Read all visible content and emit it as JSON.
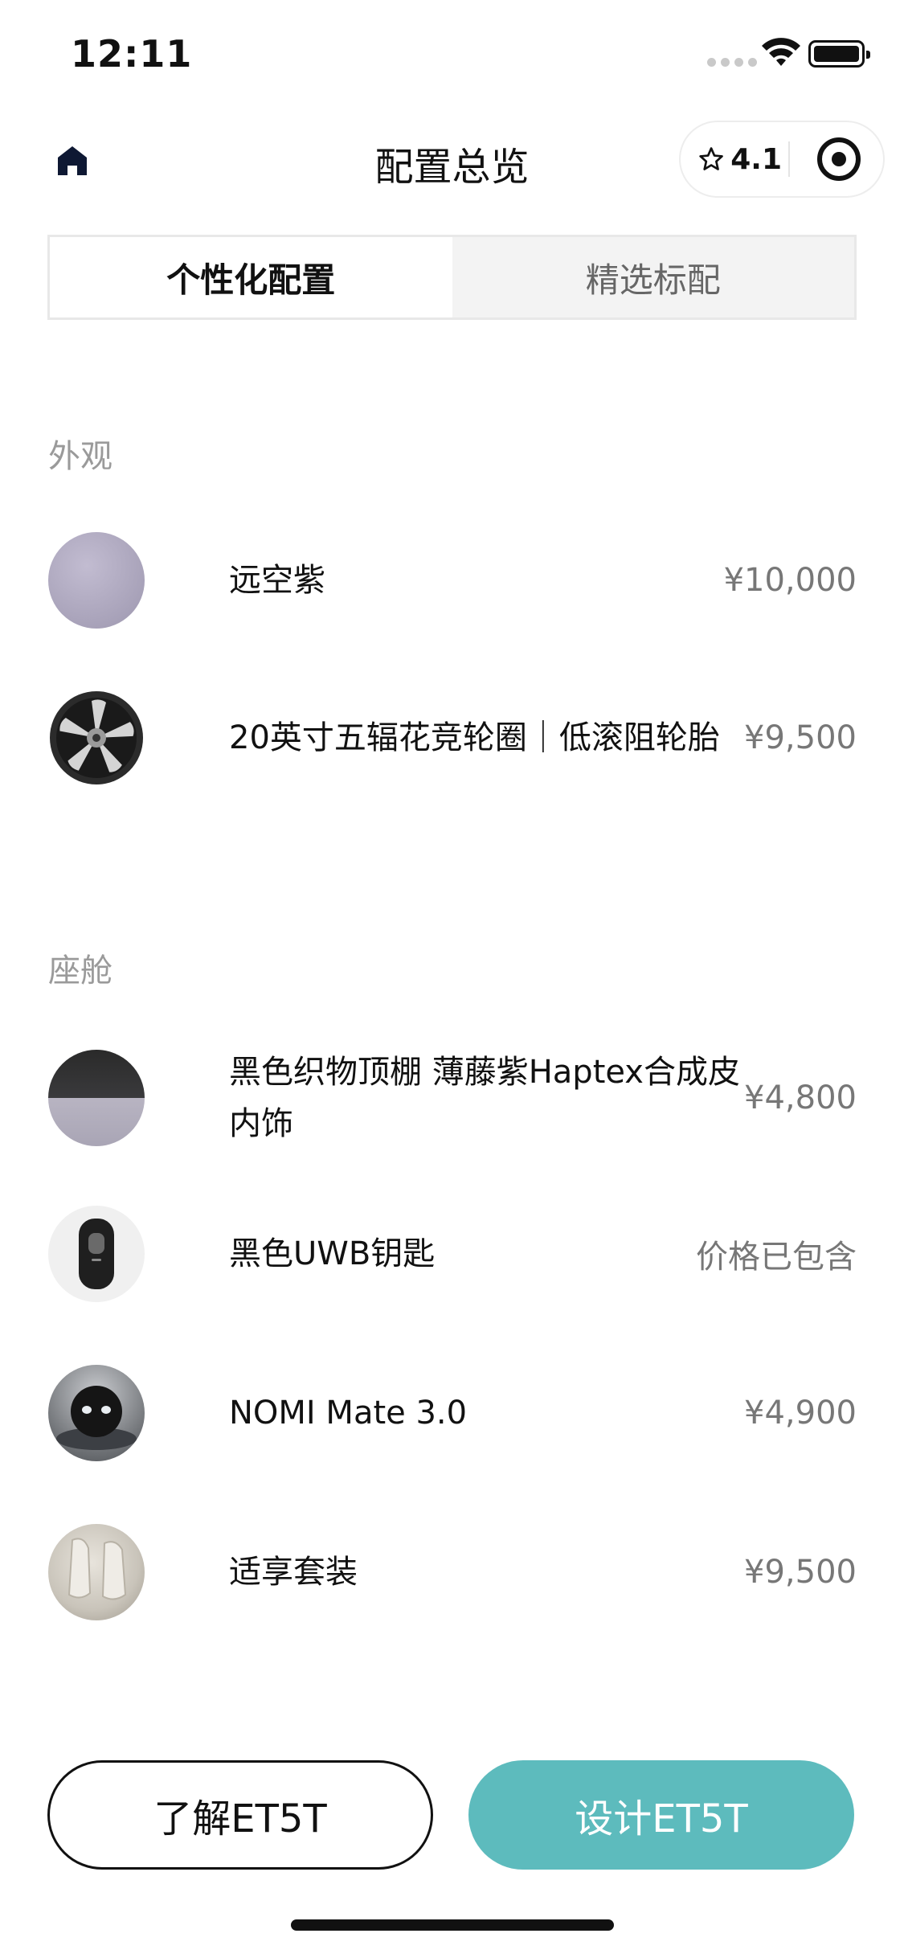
{
  "status_bar": {
    "time": "12:11"
  },
  "header": {
    "title": "配置总览",
    "rating": "4.1",
    "icons": [
      "home-icon",
      "star-icon",
      "target-icon"
    ]
  },
  "tabs": [
    {
      "label": "个性化配置",
      "active": true
    },
    {
      "label": "精选标配",
      "active": false
    }
  ],
  "sections": {
    "exterior": {
      "title": "外观",
      "items": [
        {
          "name": "远空紫",
          "price": "¥10,000"
        },
        {
          "name": "20英寸五辐花竞轮圈｜低滚阻轮胎",
          "price": "¥9,500"
        }
      ]
    },
    "cabin": {
      "title": "座舱",
      "items": [
        {
          "name": "黑色织物顶棚 薄藤紫Haptex合成皮内饰",
          "price": "¥4,800"
        },
        {
          "name": "黑色UWB钥匙",
          "price": "价格已包含"
        },
        {
          "name": "NOMI Mate 3.0",
          "price": "¥4,900"
        },
        {
          "name": "适享套装",
          "price": "¥9,500"
        }
      ]
    }
  },
  "buttons": {
    "learn": "了解ET5T",
    "design": "设计ET5T"
  },
  "colors": {
    "accent": "#5dbbbd",
    "text": "#111111",
    "muted": "#9a9a9a",
    "price": "#777777"
  }
}
